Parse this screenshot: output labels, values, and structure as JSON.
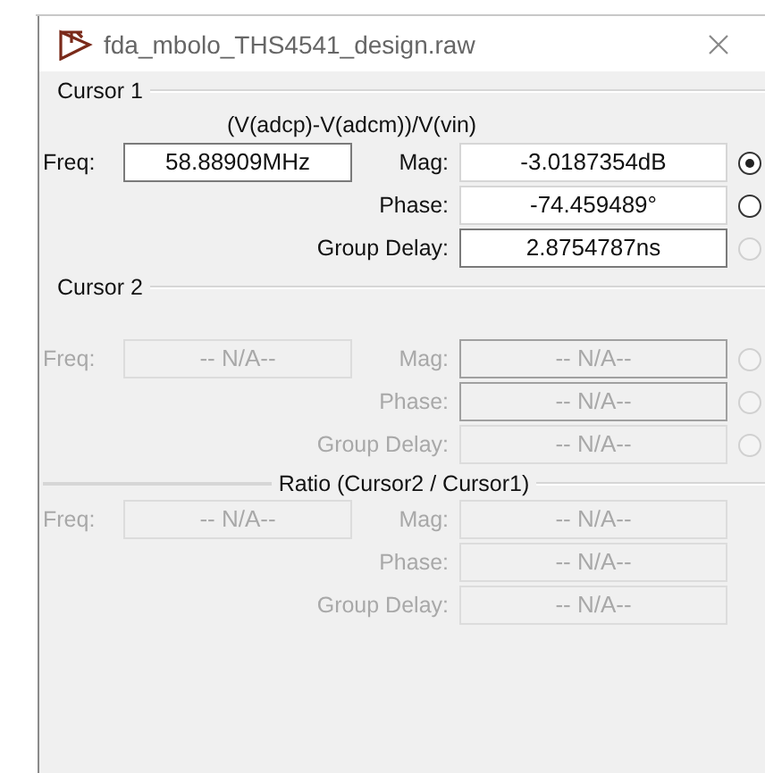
{
  "window": {
    "title": "fda_mbolo_THS4541_design.raw"
  },
  "sections": [
    {
      "kind": "cursor",
      "title": "Cursor 1",
      "disabled": false,
      "expression": "(V(adcp)-V(adcm))/V(vin)",
      "freq": {
        "label": "Freq:",
        "value": "58.88909MHz",
        "focused": true
      },
      "rows": [
        {
          "label": "Mag:",
          "value": "-3.0187354dB",
          "focused": false,
          "radio": {
            "selected": true,
            "disabled": false
          }
        },
        {
          "label": "Phase:",
          "value": "-74.459489°",
          "focused": false,
          "radio": {
            "selected": false,
            "disabled": false
          }
        },
        {
          "label": "Group Delay:",
          "value": "2.8754787ns",
          "focused": true,
          "radio": {
            "selected": false,
            "disabled": true
          }
        }
      ]
    },
    {
      "kind": "cursor",
      "title": "Cursor 2",
      "disabled": true,
      "freq": {
        "label": "Freq:",
        "value": "-- N/A--",
        "focused": false
      },
      "rows": [
        {
          "label": "Mag:",
          "value": "-- N/A--",
          "focused": true,
          "radio": {
            "selected": false,
            "disabled": true
          }
        },
        {
          "label": "Phase:",
          "value": "-- N/A--",
          "focused": true,
          "radio": {
            "selected": false,
            "disabled": true
          }
        },
        {
          "label": "Group Delay:",
          "value": "-- N/A--",
          "focused": false,
          "radio": {
            "selected": false,
            "disabled": true
          }
        }
      ]
    },
    {
      "kind": "ratio",
      "title": "Ratio (Cursor2 / Cursor1)",
      "disabled": true,
      "freq": {
        "label": "Freq:",
        "value": "-- N/A--",
        "focused": false
      },
      "rows": [
        {
          "label": "Mag:",
          "value": "-- N/A--",
          "focused": false
        },
        {
          "label": "Phase:",
          "value": "-- N/A--",
          "focused": false
        },
        {
          "label": "Group Delay:",
          "value": "-- N/A--",
          "focused": false
        }
      ]
    }
  ]
}
